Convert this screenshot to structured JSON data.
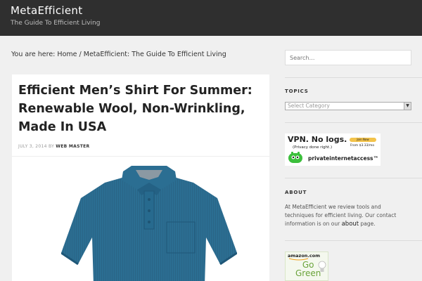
{
  "header": {
    "site_title": "MetaEfficient",
    "tagline": "The Guide To Efficient Living"
  },
  "breadcrumb": {
    "prefix": "You are here:",
    "home": "Home",
    "separator": "/",
    "current": "MetaEfficient: The Guide To Efficient Living"
  },
  "post": {
    "title": "Efficient Men’s Shirt For Summer: Renewable Wool, Non-Wrinkling, Made In USA",
    "date": "JULY 3, 2014",
    "by": "BY",
    "author": "WEB MASTER",
    "image": "polo-shirt-image"
  },
  "sidebar": {
    "search_placeholder": "Search…",
    "topics_title": "TOPICS",
    "category_select": "Select Category",
    "vpn_ad": {
      "title": "VPN. No logs.",
      "subtitle": "(Privacy done right.)",
      "button": "Join Now",
      "price": "From $3.33/mo",
      "brand": "privateinternetaccess™",
      "logo_icon": "green-robot-icon"
    },
    "about_title": "ABOUT",
    "about_text": "At MetaEfficient we review tools and techniques for efficient living. Our contact information is on our",
    "about_link": "about",
    "about_tail": "page.",
    "amazon_ad": {
      "brand": "amazon.com",
      "line1": "Go",
      "line2": "Green"
    }
  },
  "colors": {
    "header_bg": "#2f2f2f",
    "page_bg": "#f0f0f0",
    "shirt": "#2a6c8f",
    "accent_green": "#6aa33a"
  }
}
